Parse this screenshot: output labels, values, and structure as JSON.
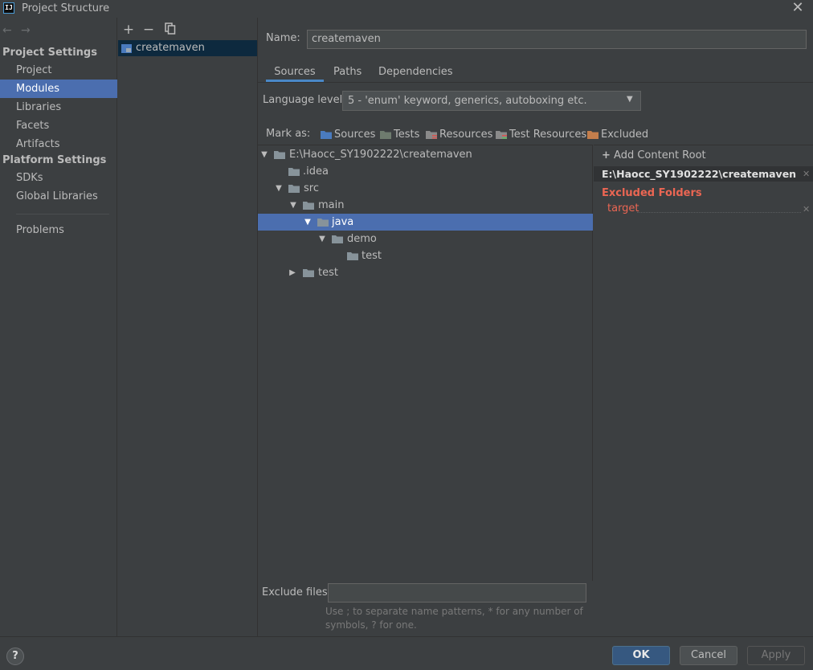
{
  "window": {
    "title": "Project Structure",
    "app_icon_text": "IJ"
  },
  "nav": {
    "back_icon": "←",
    "forward_icon": "→",
    "project_settings_header": "Project Settings",
    "project_items": [
      "Project",
      "Modules",
      "Libraries",
      "Facets",
      "Artifacts"
    ],
    "platform_settings_header": "Platform Settings",
    "platform_items": [
      "SDKs",
      "Global Libraries"
    ],
    "problems": "Problems",
    "selected": "Modules"
  },
  "modules": {
    "add_icon": "+",
    "remove_icon": "−",
    "copy_icon": "copy",
    "items": [
      "createmaven"
    ]
  },
  "module_settings": {
    "name_label": "Name:",
    "name_value": "createmaven",
    "tabs": [
      "Sources",
      "Paths",
      "Dependencies"
    ],
    "active_tab": "Sources",
    "language_level_label": "Language level:",
    "language_level_value": "5 - 'enum' keyword, generics, autoboxing etc.",
    "mark_as_label": "Mark as:",
    "mark_as_buttons": [
      {
        "label": "Sources",
        "color": "#4a7bbf"
      },
      {
        "label": "Tests",
        "color": "#6e7b6e"
      },
      {
        "label": "Resources",
        "color": "#8a8a8a"
      },
      {
        "label": "Test Resources",
        "color": "#8a8a8a"
      },
      {
        "label": "Excluded",
        "color": "#c47e4c"
      }
    ],
    "tree": [
      {
        "label": "E:\\Haocc_SY1902222\\createmaven",
        "toggle": "▼"
      },
      {
        "label": ".idea",
        "toggle": ""
      },
      {
        "label": "src",
        "toggle": "▼"
      },
      {
        "label": "main",
        "toggle": "▼"
      },
      {
        "label": "java",
        "toggle": "▼"
      },
      {
        "label": "demo",
        "toggle": "▼"
      },
      {
        "label": "test",
        "toggle": ""
      },
      {
        "label": "test",
        "toggle": "▶"
      }
    ],
    "selected_tree_item": "java",
    "add_content_root": "Add Content Root",
    "add_content_root_icon": "+",
    "content_root_path": "E:\\Haocc_SY1902222\\createmaven",
    "excluded_folders_title": "Excluded Folders",
    "excluded_folders": [
      "target"
    ],
    "exclude_files_label": "Exclude files:",
    "exclude_files_value": "",
    "exclude_files_hint": "Use ; to separate name patterns, * for any number of symbols, ? for one."
  },
  "buttons": {
    "help": "?",
    "ok": "OK",
    "cancel": "Cancel",
    "apply": "Apply"
  },
  "colors": {
    "accent": "#4b6eaf",
    "excluded_text": "#eb6653",
    "folder_gray": "#87939a"
  }
}
